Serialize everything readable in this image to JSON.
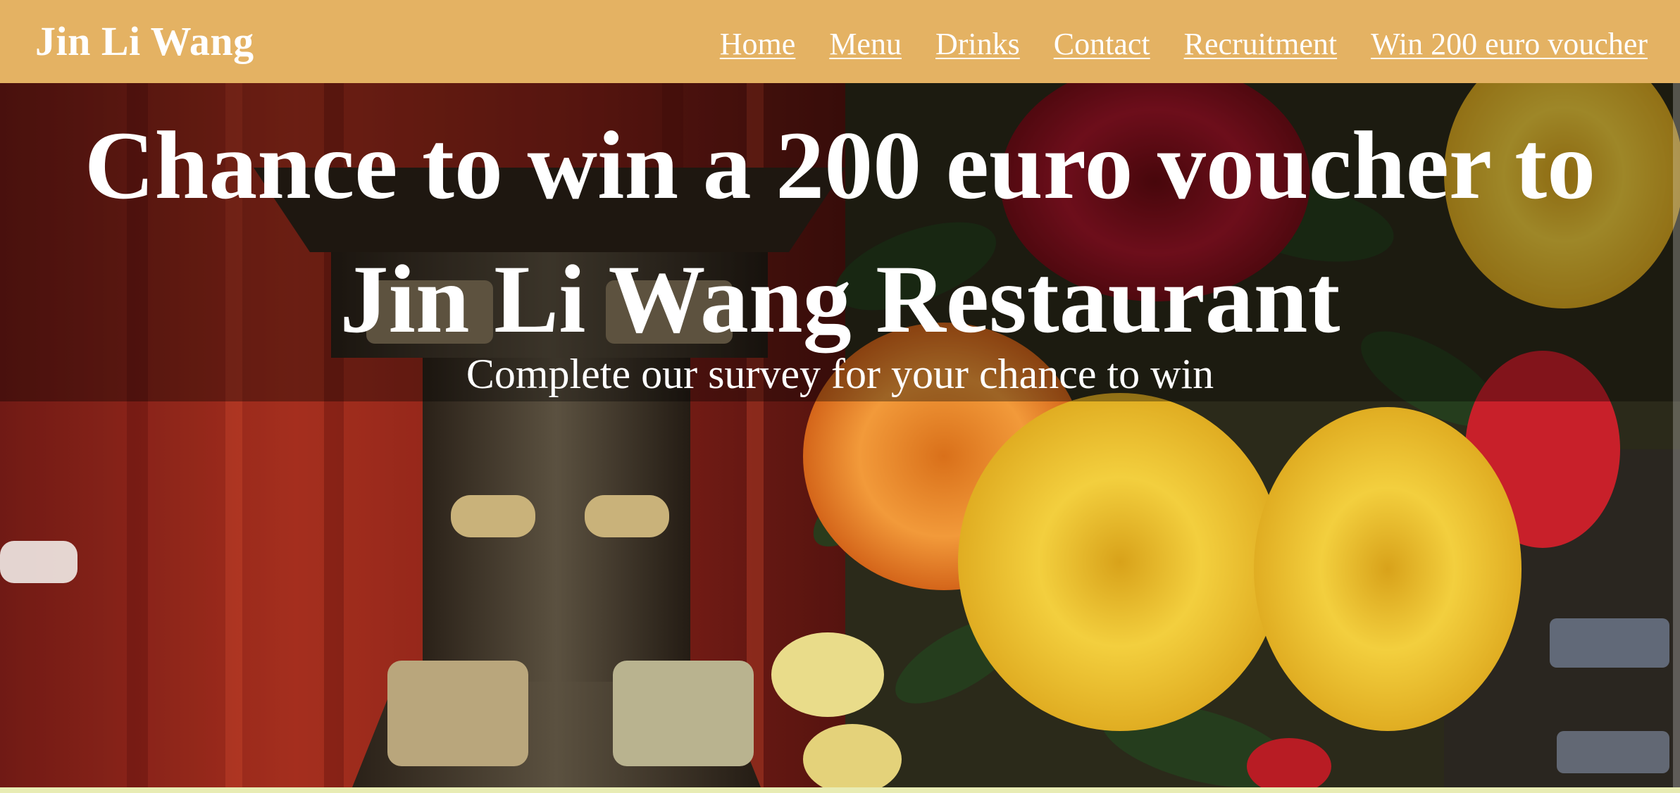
{
  "navbar": {
    "brand": "Jin Li Wang",
    "links": [
      {
        "label": "Home"
      },
      {
        "label": "Menu"
      },
      {
        "label": "Drinks"
      },
      {
        "label": "Contact"
      },
      {
        "label": "Recruitment"
      },
      {
        "label": "Win 200 euro voucher"
      }
    ]
  },
  "hero": {
    "headline_line1": "Chance to win a 200 euro voucher to",
    "headline_line2": "Jin Li Wang Restaurant",
    "subline": "Complete our survey for your chance to win",
    "image_description_icon": "restaurant-interior-flowers-photo"
  },
  "colors": {
    "navbar_bg": "#e4b263",
    "nav_text": "#ffffff",
    "headline_text": "#ffffff",
    "overlay": "rgba(0,0,0,0.35)",
    "page_bottom": "#e8ecb4"
  }
}
